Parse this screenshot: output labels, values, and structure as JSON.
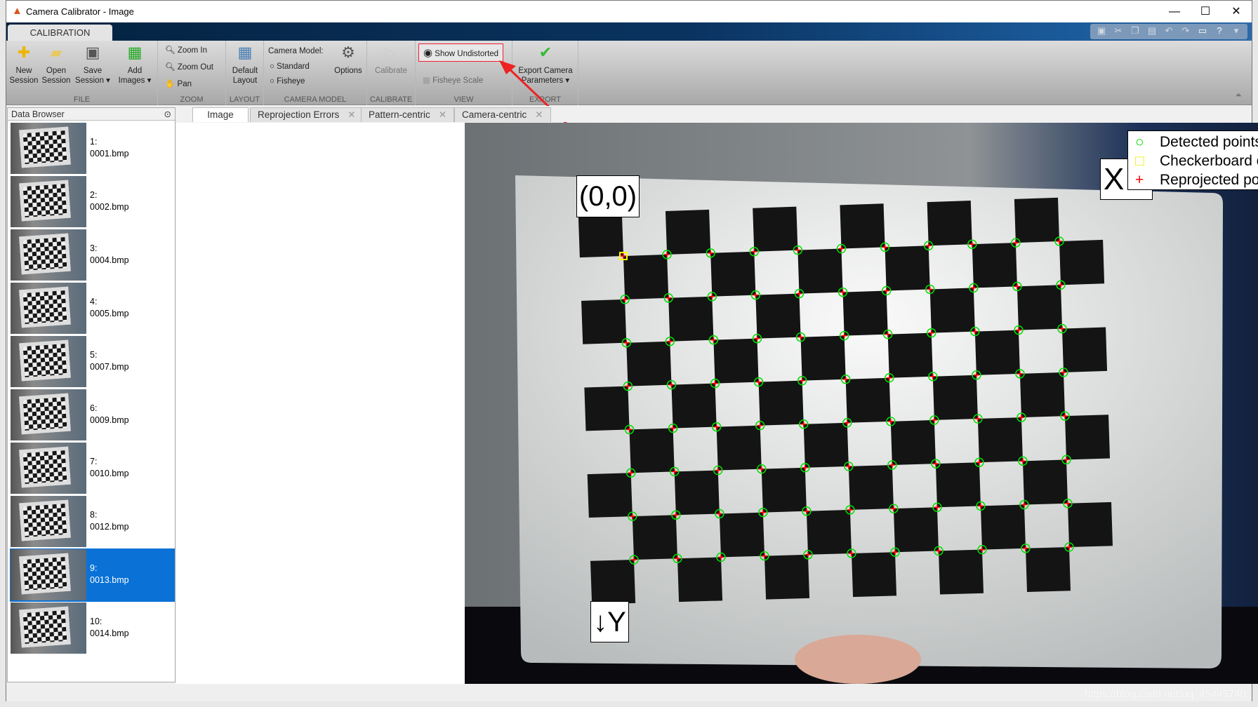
{
  "window": {
    "title": "Camera Calibrator - Image",
    "controls": [
      "minimize",
      "maximize",
      "close"
    ]
  },
  "ribbon": {
    "tab": "CALIBRATION",
    "quick_access": [
      "save-icon",
      "cut-icon",
      "copy-icon",
      "paste-icon",
      "undo-icon",
      "redo-icon",
      "window-icon",
      "help-icon",
      "menu-icon"
    ],
    "file": {
      "label": "FILE",
      "new": "New Session",
      "open": "Open Session",
      "save": "Save Session ▾",
      "add": "Add Images ▾"
    },
    "zoom": {
      "label": "ZOOM",
      "zoom_in": "Zoom In",
      "zoom_out": "Zoom Out",
      "pan": "Pan"
    },
    "layout": {
      "label": "LAYOUT",
      "default": "Default Layout"
    },
    "camera_model": {
      "label": "CAMERA MODEL",
      "title": "Camera Model:",
      "standard": "Standard",
      "fisheye": "Fisheye",
      "options": "Options",
      "selected": "none"
    },
    "calibrate": {
      "label": "CALIBRATE",
      "calibrate": "Calibrate"
    },
    "view": {
      "label": "VIEW",
      "show_undistorted": "Show Undistorted",
      "fisheye_scale": "Fisheye Scale"
    },
    "export": {
      "label": "EXPORT",
      "export": "Export Camera Parameters ▾"
    }
  },
  "doc_tabs": [
    {
      "label": "Image",
      "active": true
    },
    {
      "label": "Reprojection Errors"
    },
    {
      "label": "Pattern-centric"
    },
    {
      "label": "Camera-centric"
    }
  ],
  "browser": {
    "title": "Data Browser",
    "selected": 9,
    "items": [
      {
        "n": "1:",
        "file": "0001.bmp"
      },
      {
        "n": "2:",
        "file": "0002.bmp"
      },
      {
        "n": "3:",
        "file": "0004.bmp"
      },
      {
        "n": "4:",
        "file": "0005.bmp"
      },
      {
        "n": "5:",
        "file": "0007.bmp"
      },
      {
        "n": "6:",
        "file": "0009.bmp"
      },
      {
        "n": "7:",
        "file": "0010.bmp"
      },
      {
        "n": "8:",
        "file": "0012.bmp"
      },
      {
        "n": "9:",
        "file": "0013.bmp"
      },
      {
        "n": "10:",
        "file": "0014.bmp"
      }
    ]
  },
  "image": {
    "origin_label": "(0,0)",
    "x_label": "X",
    "y_label": "↓Y",
    "board_rows": 8,
    "board_cols": 11,
    "legend": [
      "Detected points",
      "Checkerboard origin",
      "Reprojected points"
    ],
    "colors": {
      "detected": "#00e000",
      "origin": "#ffff00",
      "reprojected": "#ff0000"
    }
  },
  "watermark": "https://blog.csdn.net/qq_45445740"
}
